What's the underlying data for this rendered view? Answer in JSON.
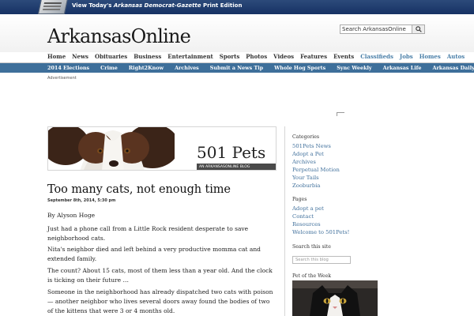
{
  "topbar": {
    "promo_prefix": "View Today's ",
    "promo_title": "Arkansas Democrat-Gazette",
    "promo_suffix": " Print Edition"
  },
  "header": {
    "logo": "ArkansasOnline",
    "search_placeholder": "Search ArkansasOnline",
    "search_icon": "magnifier-icon"
  },
  "nav": {
    "items": [
      "Home",
      "News",
      "Obituaries",
      "Business",
      "Entertainment",
      "Sports",
      "Photos",
      "Videos",
      "Features",
      "Events",
      "Classifieds",
      "Jobs",
      "Homes",
      "Autos"
    ]
  },
  "subnav": {
    "items": [
      "2014 Elections",
      "Crime",
      "Right2Know",
      "Archives",
      "Submit a News Tip",
      "Whole Hog Sports",
      "Sync Weekly",
      "Arkansas Life",
      "Arkansas Daily Deal"
    ]
  },
  "ad_label": "Advertisement",
  "banner": {
    "title": "501 Pets",
    "tagline": "AN ARKANSASONLINE BLOG"
  },
  "article": {
    "title": "Too many cats, not enough time",
    "date": "September 8th, 2014, 5:30 pm",
    "paragraphs": [
      "By Alyson Hoge",
      "Just had a phone call from a Little Rock resident desperate to save neighborhood cats.",
      "Nita's neighbor died and left behind a very productive momma cat and extended family.",
      "The count? About 15 cats, most of them less than a year old. And the clock is ticking on their future …",
      "Someone in the neighborhood has already dispatched two cats with poison — another neighbor who lives several doors away found the bodies of two of the kittens that were 3 or 4 months old."
    ]
  },
  "sidebar": {
    "categories_heading": "Categories",
    "categories": [
      "501Pets News",
      "Adopt a Pet",
      "Archives",
      "Perpetual Motion",
      "Your Tails",
      "Zooburbia"
    ],
    "pages_heading": "Pages",
    "pages": [
      "Adopt a pet",
      "Contact",
      "Resources",
      "Welcome to 501Pets!"
    ],
    "search_heading": "Search this site",
    "search_placeholder": "Search this blog",
    "pet_heading": "Pet of the Week"
  },
  "colors": {
    "topbar": "#163264",
    "subnav": "#3e6f9a",
    "link": "#3f6f9b",
    "classified_links": "#4a7fa8"
  }
}
